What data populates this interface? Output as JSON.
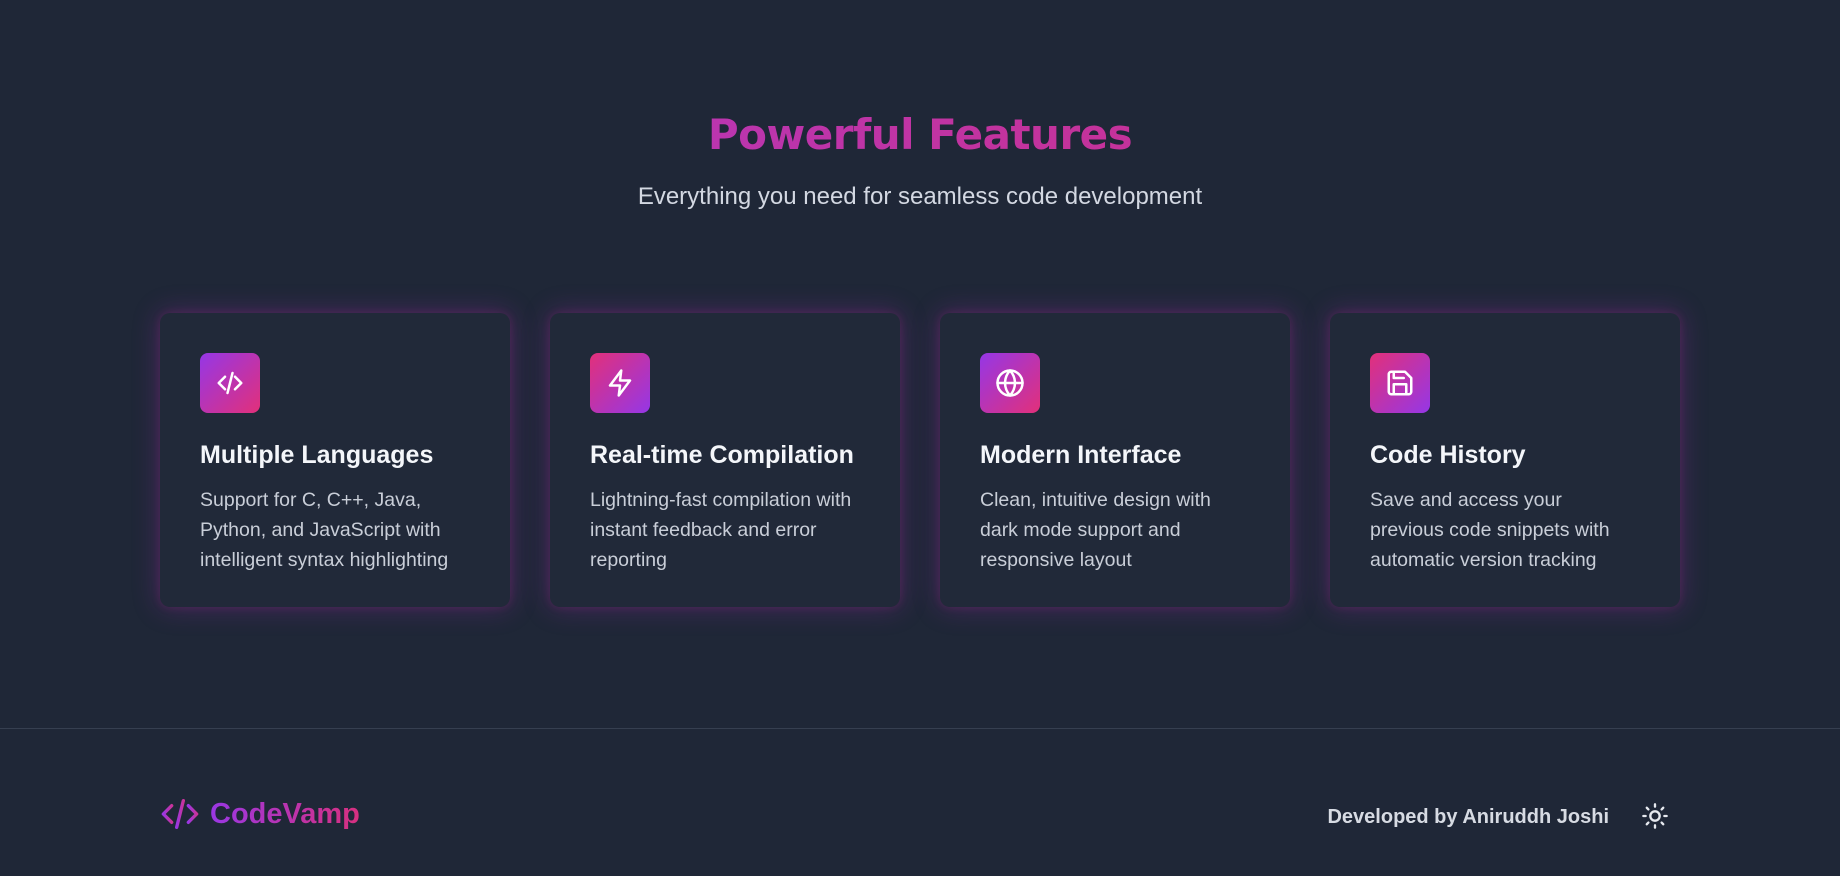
{
  "features": {
    "title": "Powerful Features",
    "subtitle": "Everything you need for seamless code development",
    "cards": [
      {
        "icon": "code-icon",
        "title": "Multiple Languages",
        "description": "Support for C, C++, Java, Python, and JavaScript with intelligent syntax highlighting"
      },
      {
        "icon": "lightning-icon",
        "title": "Real-time Compilation",
        "description": "Lightning-fast compilation with instant feedback and error reporting"
      },
      {
        "icon": "globe-icon",
        "title": "Modern Interface",
        "description": "Clean, intuitive design with dark mode support and responsive layout"
      },
      {
        "icon": "save-icon",
        "title": "Code History",
        "description": "Save and access your previous code snippets with automatic version tracking"
      }
    ]
  },
  "footer": {
    "brand_icon": "code-icon",
    "brand_name": "CodeVamp",
    "credit": "Developed by Aniruddh Joshi",
    "theme_toggle_icon": "sun-icon"
  },
  "colors": {
    "background": "#1f2737",
    "card_background": "#212939",
    "accent_purple": "#9537e6",
    "accent_pink": "#e2307a"
  }
}
